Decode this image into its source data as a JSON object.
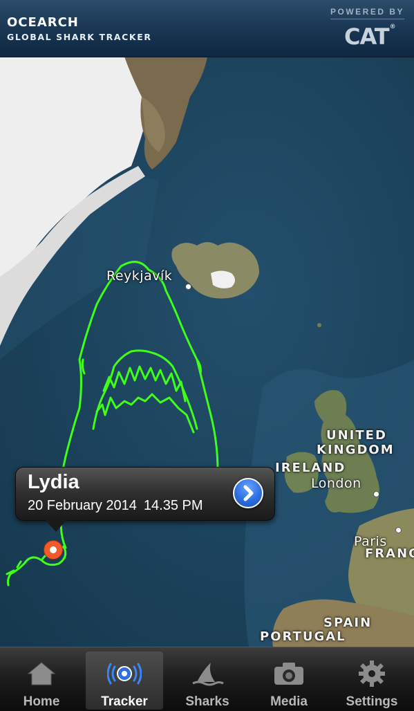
{
  "header": {
    "brand": "OCEARCH",
    "subtitle": "GLOBAL SHARK TRACKER",
    "powered_by": "POWERED BY",
    "sponsor": "CAT",
    "sponsor_mark": "®"
  },
  "map": {
    "cities": {
      "reykjavik": "Reykjavík",
      "london": "London",
      "paris": "Paris"
    },
    "countries": {
      "uk_line1": "UNITED",
      "uk_line2": "KINGDOM",
      "ireland": "IRELAND",
      "france": "FRANCE",
      "spain": "SPAIN",
      "portugal": "PORTUGAL"
    },
    "track_color": "#3fff1a",
    "pin_color": "#f05a2a"
  },
  "callout": {
    "name": "Lydia",
    "date": "20 February 2014",
    "time": "14.35 PM",
    "disclosure_icon": "chevron-right-icon"
  },
  "tabs": [
    {
      "label": "Home",
      "icon": "home-icon",
      "active": false
    },
    {
      "label": "Tracker",
      "icon": "tracker-icon",
      "active": true
    },
    {
      "label": "Sharks",
      "icon": "shark-fin-icon",
      "active": false
    },
    {
      "label": "Media",
      "icon": "camera-icon",
      "active": false
    },
    {
      "label": "Settings",
      "icon": "gear-icon",
      "active": false
    }
  ]
}
